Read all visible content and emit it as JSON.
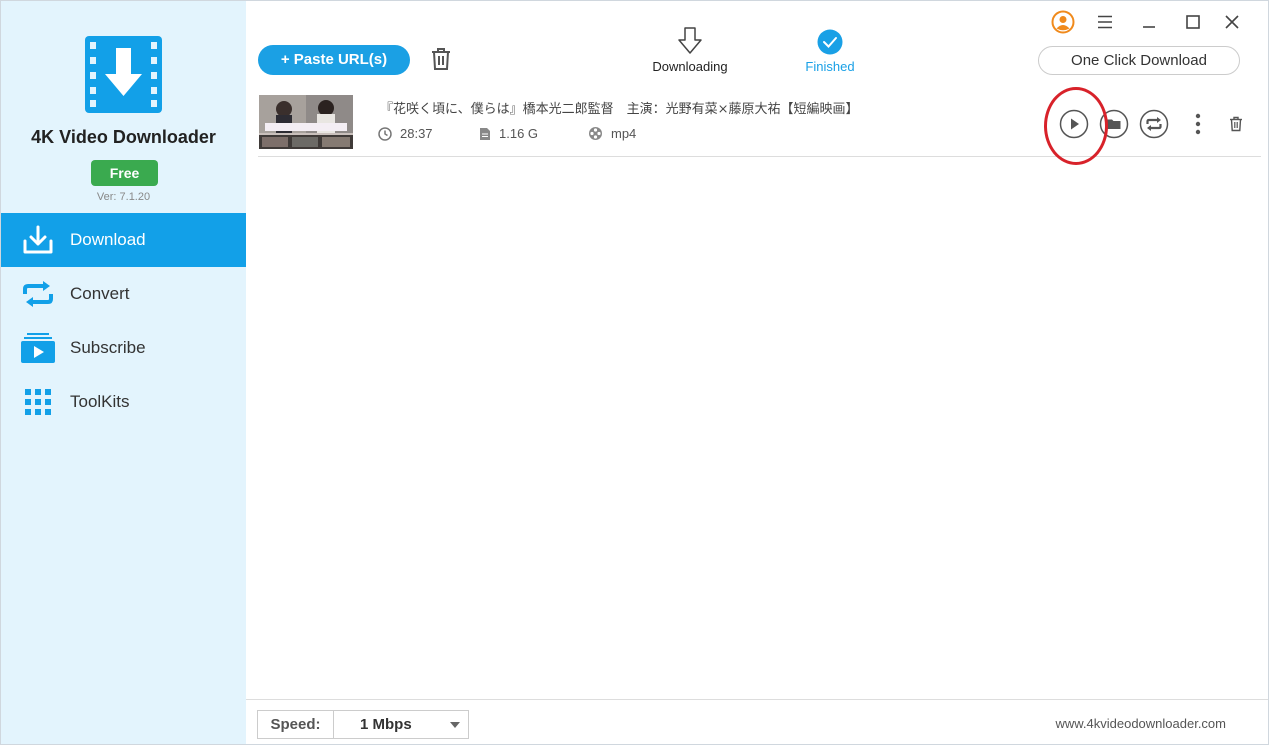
{
  "app": {
    "name": "4K Video Downloader",
    "badge": "Free",
    "version": "Ver: 7.1.20"
  },
  "sidebar": {
    "items": [
      {
        "label": "Download",
        "icon": "download-icon",
        "active": true
      },
      {
        "label": "Convert",
        "icon": "convert-icon",
        "active": false
      },
      {
        "label": "Subscribe",
        "icon": "subscribe-icon",
        "active": false
      },
      {
        "label": "ToolKits",
        "icon": "grid-icon",
        "active": false
      }
    ]
  },
  "toolbar": {
    "paste_label": "+ Paste URL(s)",
    "tabs": [
      {
        "label": "Downloading",
        "active": false
      },
      {
        "label": "Finished",
        "active": true
      }
    ],
    "one_click_label": "One Click Download"
  },
  "items": [
    {
      "title": "『花咲く頃に、僕らは』橋本光二郎監督　主演：光野有菜×藤原大祐【短編映画】",
      "duration": "28:37",
      "size": "1.16 G",
      "format": "mp4"
    }
  ],
  "footer": {
    "speed_label": "Speed:",
    "speed_value": "1 Mbps",
    "website": "www.4kvideodownloader.com"
  },
  "colors": {
    "accent": "#12a0e8",
    "sidebar_bg": "#e3f4fd",
    "free_badge": "#3aaa4f",
    "highlight": "#d8222a",
    "user_icon": "#f08a1c"
  }
}
